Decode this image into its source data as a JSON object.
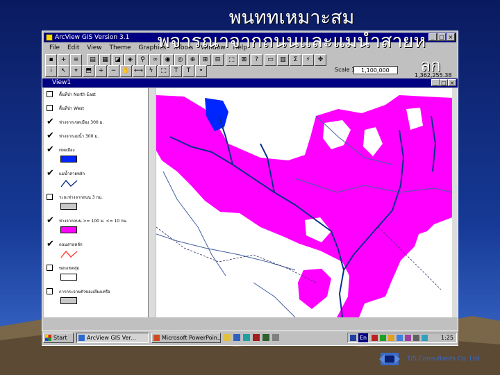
{
  "slide": {
    "title_line1": "พนททเหมาะสม",
    "title_line2": "พจารณาจากถนนและแมนำสายห",
    "title_line3": "ลก",
    "footer": "TIS Consultants Co. Ltd"
  },
  "app": {
    "title": "ArcView GIS Version 3.1",
    "menus": [
      "File",
      "Edit",
      "View",
      "Theme",
      "Graphics",
      "XTools",
      "Window",
      "Help"
    ],
    "scale_label": "Scale 1:",
    "scale_value": "1,100,000",
    "coords": "1,362,255.38",
    "view_title": "View1"
  },
  "layers": [
    {
      "label": "ตื้นที่ป่า North East",
      "checked": false,
      "symbol": "none"
    },
    {
      "label": "ตื้นที่ป่า West",
      "checked": false,
      "symbol": "none"
    },
    {
      "label": "ห่างจากเขตเมือง 300 ม.",
      "checked": true,
      "symbol": "none"
    },
    {
      "label": "ห่างจากแม่น้ำ 300 ม.",
      "checked": true,
      "symbol": "none"
    },
    {
      "label": "เขตเมือง",
      "checked": true,
      "symbol": "fill-blue"
    },
    {
      "label": "แม่น้ำสายหลัก",
      "checked": true,
      "symbol": "line-blue"
    },
    {
      "label": "ระยะห่างจากถนน 3 กม.",
      "checked": false,
      "symbol": "fill-gray"
    },
    {
      "label": "ห่างจากถนน >= 100 ม. <= 10 กม.",
      "checked": true,
      "symbol": "fill-magenta"
    },
    {
      "label": "ถนนสายหลัก",
      "checked": true,
      "symbol": "line-red"
    },
    {
      "label": "ขอบเขตลุ่ม",
      "checked": false,
      "symbol": "fill-white"
    },
    {
      "label": "การกระจายตัวของเสียงเครือ",
      "checked": false,
      "symbol": "fill-gray"
    }
  ],
  "taskbar": {
    "start": "Start",
    "tasks": [
      "ArcView GIS Ver...",
      "Microsoft PowerPoin..."
    ],
    "tray_text": "En",
    "clock": "1:25"
  },
  "colors": {
    "magenta": "#ff00ff",
    "river": "#0a2f8c",
    "city": "#0026ff",
    "road": "#ff3b30"
  }
}
